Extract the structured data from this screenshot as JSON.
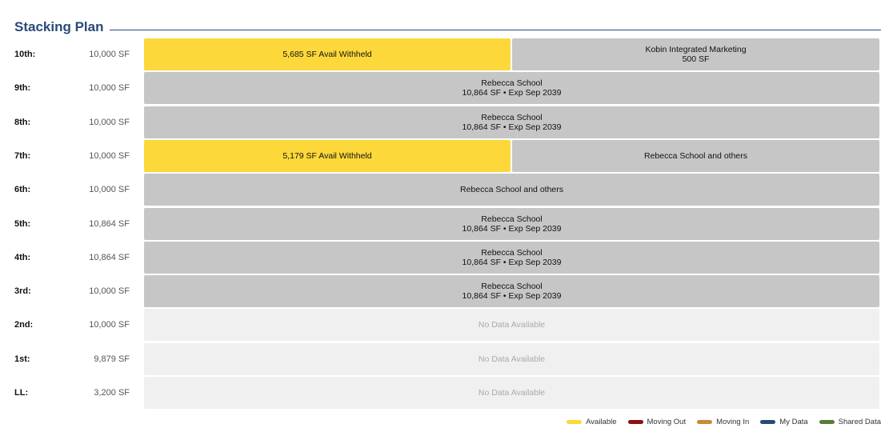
{
  "title": "Stacking Plan",
  "floors": [
    {
      "label": "10th:",
      "sf": "10,000 SF",
      "segments": [
        {
          "type": "available",
          "lines": [
            "5,685 SF Avail Withheld"
          ],
          "flex": 458
        },
        {
          "type": "tenant",
          "lines": [
            "Kobin Integrated Marketing",
            "500 SF"
          ],
          "flex": 459
        }
      ]
    },
    {
      "label": "9th:",
      "sf": "10,000 SF",
      "segments": [
        {
          "type": "tenant",
          "lines": [
            "Rebecca School",
            "10,864 SF • Exp Sep 2039"
          ],
          "flex": 1
        }
      ]
    },
    {
      "label": "8th:",
      "sf": "10,000 SF",
      "segments": [
        {
          "type": "tenant",
          "lines": [
            "Rebecca School",
            "10,864 SF • Exp Sep 2039"
          ],
          "flex": 1
        }
      ]
    },
    {
      "label": "7th:",
      "sf": "10,000 SF",
      "segments": [
        {
          "type": "available",
          "lines": [
            "5,179 SF Avail Withheld"
          ],
          "flex": 458
        },
        {
          "type": "tenant",
          "lines": [
            "Rebecca School and others"
          ],
          "flex": 459
        }
      ]
    },
    {
      "label": "6th:",
      "sf": "10,000 SF",
      "segments": [
        {
          "type": "tenant",
          "lines": [
            "Rebecca School and others"
          ],
          "flex": 1
        }
      ]
    },
    {
      "label": "5th:",
      "sf": "10,864 SF",
      "segments": [
        {
          "type": "tenant",
          "lines": [
            "Rebecca School",
            "10,864 SF • Exp Sep 2039"
          ],
          "flex": 1
        }
      ]
    },
    {
      "label": "4th:",
      "sf": "10,864 SF",
      "segments": [
        {
          "type": "tenant",
          "lines": [
            "Rebecca School",
            "10,864 SF • Exp Sep 2039"
          ],
          "flex": 1
        }
      ]
    },
    {
      "label": "3rd:",
      "sf": "10,000 SF",
      "segments": [
        {
          "type": "tenant",
          "lines": [
            "Rebecca School",
            "10,864 SF • Exp Sep 2039"
          ],
          "flex": 1
        }
      ]
    },
    {
      "label": "2nd:",
      "sf": "10,000 SF",
      "segments": [
        {
          "type": "nodata",
          "lines": [
            "No Data Available"
          ],
          "flex": 1
        }
      ]
    },
    {
      "label": "1st:",
      "sf": "9,879 SF",
      "segments": [
        {
          "type": "nodata",
          "lines": [
            "No Data Available"
          ],
          "flex": 1
        }
      ]
    },
    {
      "label": "LL:",
      "sf": "3,200 SF",
      "segments": [
        {
          "type": "nodata",
          "lines": [
            "No Data Available"
          ],
          "flex": 1
        }
      ]
    }
  ],
  "legend": [
    {
      "label": "Available",
      "color": "#fdd83b"
    },
    {
      "label": "Moving Out",
      "color": "#8b1111"
    },
    {
      "label": "Moving In",
      "color": "#c88a36"
    },
    {
      "label": "My Data",
      "color": "#2a4a78"
    },
    {
      "label": "Shared Data",
      "color": "#5a7a3a"
    }
  ]
}
